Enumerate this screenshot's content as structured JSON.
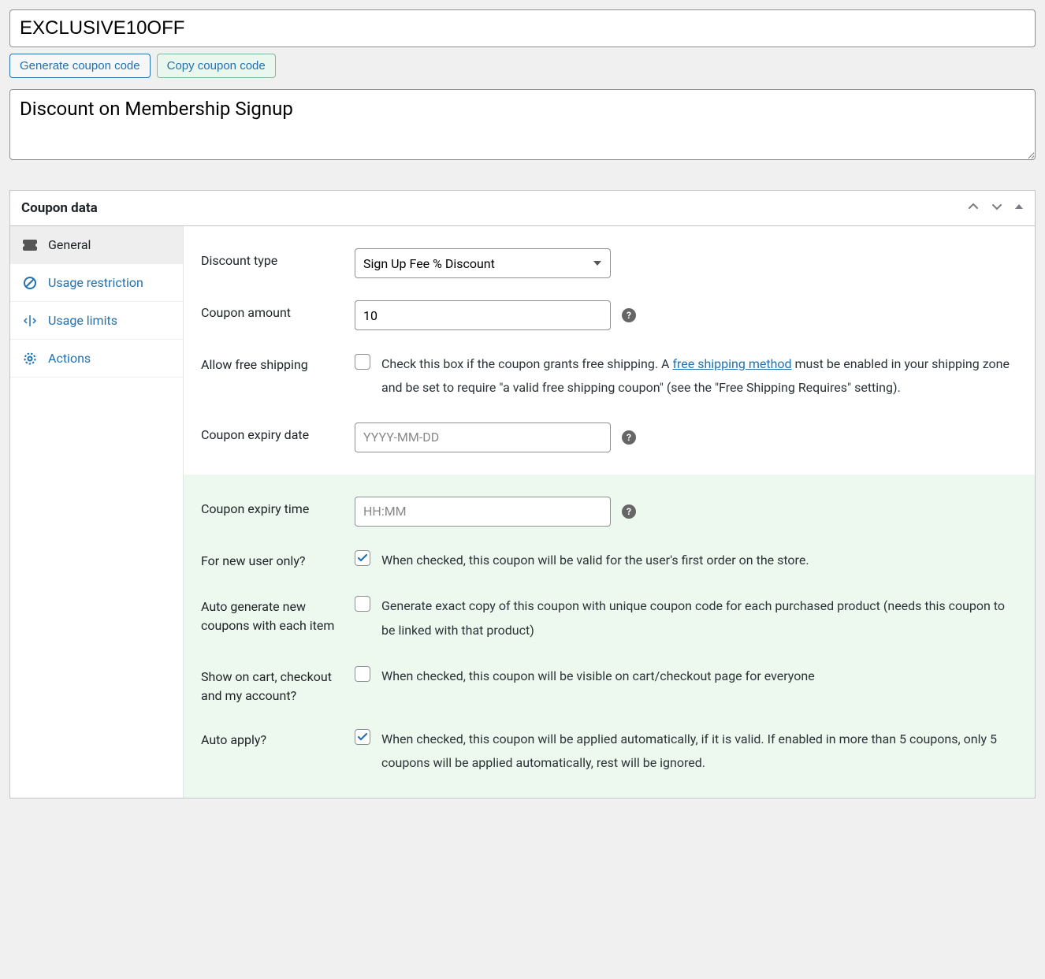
{
  "coupon_code": "EXCLUSIVE10OFF",
  "buttons": {
    "generate": "Generate coupon code",
    "copy": "Copy coupon code"
  },
  "description": "Discount on Membership Signup",
  "panel": {
    "title": "Coupon data"
  },
  "tabs": {
    "general": "General",
    "usage_restriction": "Usage restriction",
    "usage_limits": "Usage limits",
    "actions": "Actions"
  },
  "fields": {
    "discount_type": {
      "label": "Discount type",
      "value": "Sign Up Fee % Discount"
    },
    "coupon_amount": {
      "label": "Coupon amount",
      "value": "10"
    },
    "free_shipping": {
      "label": "Allow free shipping",
      "desc_before": "Check this box if the coupon grants free shipping. A ",
      "link": "free shipping method",
      "desc_after": " must be enabled in your shipping zone and be set to require \"a valid free shipping coupon\" (see the \"Free Shipping Requires\" setting)."
    },
    "expiry_date": {
      "label": "Coupon expiry date",
      "placeholder": "YYYY-MM-DD"
    },
    "expiry_time": {
      "label": "Coupon expiry time",
      "placeholder": "HH:MM"
    },
    "new_user": {
      "label": "For new user only?",
      "desc": "When checked, this coupon will be valid for the user's first order on the store."
    },
    "auto_generate": {
      "label": "Auto generate new coupons with each item",
      "desc": "Generate exact copy of this coupon with unique coupon code for each purchased product (needs this coupon to be linked with that product)"
    },
    "show_on_cart": {
      "label": "Show on cart, checkout and my account?",
      "desc": "When checked, this coupon will be visible on cart/checkout page for everyone"
    },
    "auto_apply": {
      "label": "Auto apply?",
      "desc": "When checked, this coupon will be applied automatically, if it is valid. If enabled in more than 5 coupons, only 5 coupons will be applied automatically, rest will be ignored."
    }
  }
}
